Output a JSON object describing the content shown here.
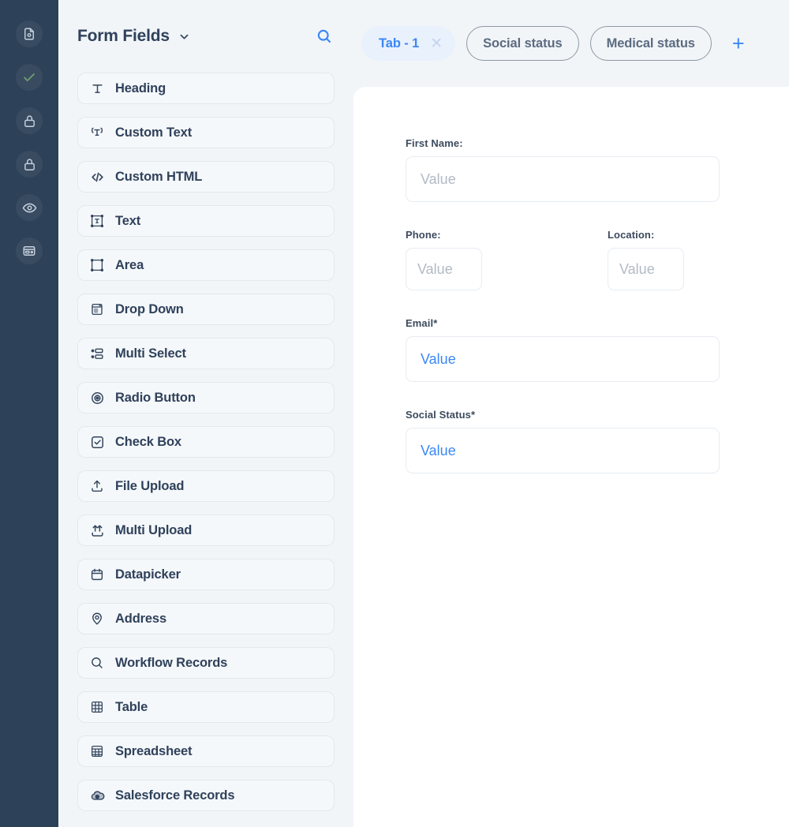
{
  "rail": {
    "items": [
      {
        "name": "document-icon",
        "title": "Document"
      },
      {
        "name": "check-icon",
        "title": "Approved"
      },
      {
        "name": "lock-icon",
        "title": "Locked"
      },
      {
        "name": "lock-alt-icon",
        "title": "Permissions"
      },
      {
        "name": "eye-icon",
        "title": "Preview"
      },
      {
        "name": "card-icon",
        "title": "Layout"
      }
    ]
  },
  "panel": {
    "title": "Form Fields",
    "chevron_icon": "chevron-down-icon",
    "search_icon": "search-icon",
    "items": [
      {
        "label": "Heading",
        "icon": "heading-text-icon"
      },
      {
        "label": "Custom Text",
        "icon": "custom-text-icon"
      },
      {
        "label": "Custom HTML",
        "icon": "code-brackets-icon"
      },
      {
        "label": "Text",
        "icon": "text-field-icon"
      },
      {
        "label": "Area",
        "icon": "text-area-icon"
      },
      {
        "label": "Drop Down",
        "icon": "dropdown-icon"
      },
      {
        "label": "Multi Select",
        "icon": "multi-select-icon"
      },
      {
        "label": "Radio Button",
        "icon": "radio-button-icon"
      },
      {
        "label": "Check Box",
        "icon": "check-box-icon"
      },
      {
        "label": "File Upload",
        "icon": "upload-icon"
      },
      {
        "label": "Multi Upload",
        "icon": "multi-upload-icon"
      },
      {
        "label": "Datapicker",
        "icon": "calendar-icon"
      },
      {
        "label": "Address",
        "icon": "map-pin-icon"
      },
      {
        "label": "Workflow Records",
        "icon": "search-records-icon"
      },
      {
        "label": "Table",
        "icon": "table-grid-icon"
      },
      {
        "label": "Spreadsheet",
        "icon": "spreadsheet-icon"
      },
      {
        "label": "Salesforce Records",
        "icon": "salesforce-cloud-icon"
      }
    ]
  },
  "builder": {
    "tabs": [
      {
        "label": "Tab - 1",
        "active": true,
        "close_icon": "close-icon"
      },
      {
        "label": "Social status",
        "active": false
      },
      {
        "label": "Medical status",
        "active": false
      }
    ],
    "add_tab_label": "+",
    "accent_color": "#3b87f7",
    "active_tab_bg": "#e9f1fd",
    "form": {
      "fields": [
        {
          "label": "First Name:",
          "value": "Value",
          "required": false,
          "accent": false,
          "size": "lg"
        },
        {
          "label": "Phone:",
          "value": "Value",
          "required": false,
          "accent": false,
          "size": "sm"
        },
        {
          "label": "Location:",
          "value": "Value",
          "required": false,
          "accent": false,
          "size": "sm"
        },
        {
          "label": "Email",
          "value": "Value",
          "required": true,
          "accent": true,
          "size": "lg"
        },
        {
          "label": "Social Status",
          "value": "Value",
          "required": true,
          "accent": true,
          "size": "lg"
        }
      ],
      "required_marker": "*"
    }
  }
}
